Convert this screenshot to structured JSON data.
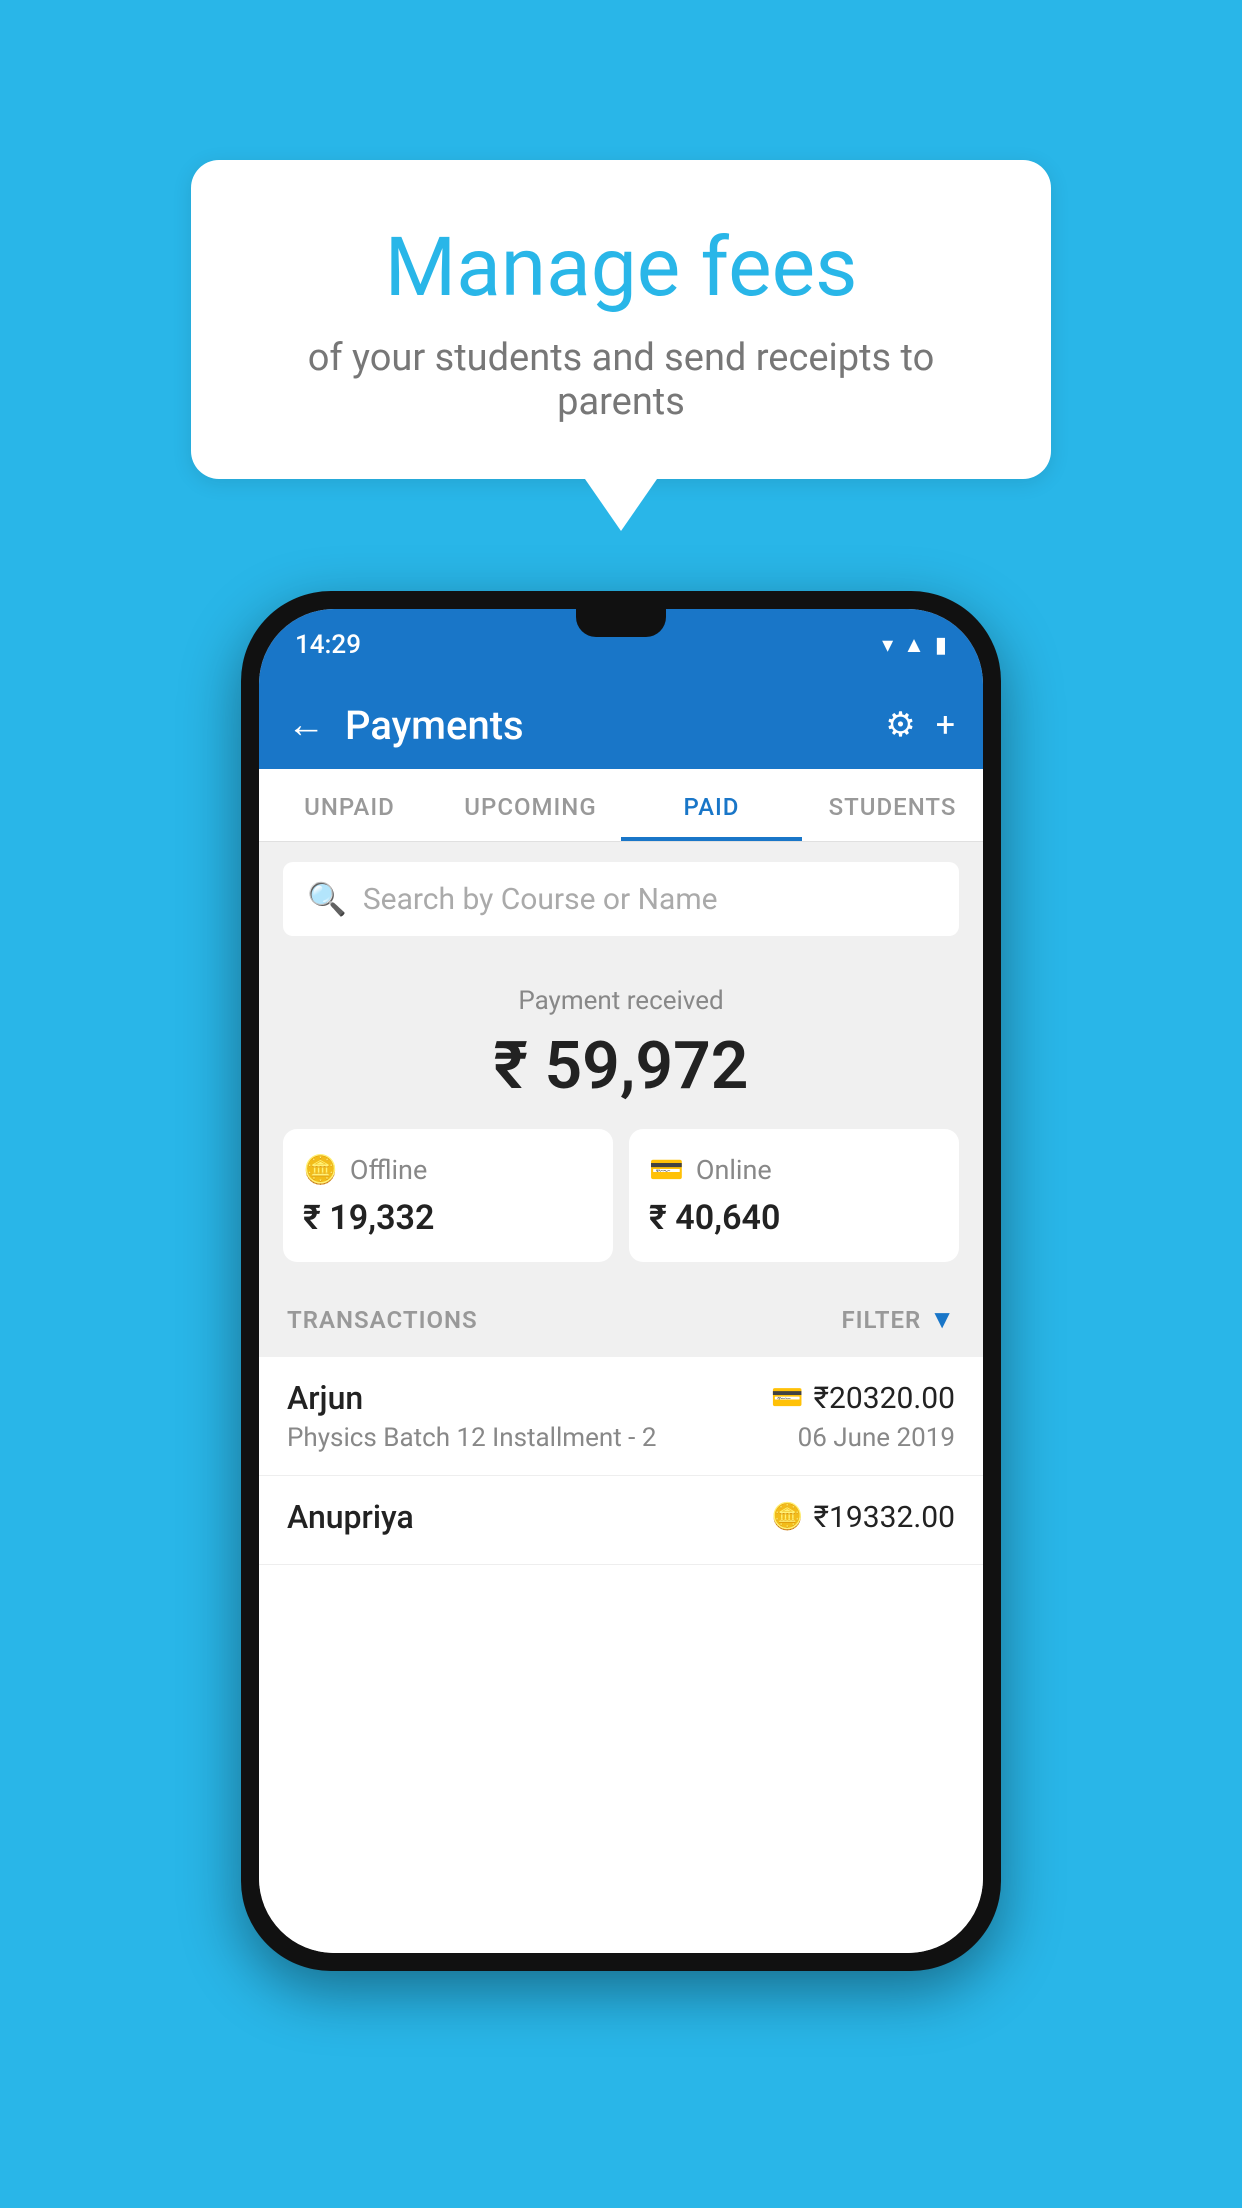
{
  "background_color": "#29b6e8",
  "speech_bubble": {
    "title": "Manage fees",
    "subtitle": "of your students and send receipts to parents"
  },
  "phone": {
    "status_bar": {
      "time": "14:29",
      "icons": [
        "wifi",
        "signal",
        "battery"
      ]
    },
    "header": {
      "title": "Payments",
      "back_label": "←",
      "gear_icon": "⚙",
      "plus_icon": "+"
    },
    "tabs": [
      {
        "label": "UNPAID",
        "active": false
      },
      {
        "label": "UPCOMING",
        "active": false
      },
      {
        "label": "PAID",
        "active": true
      },
      {
        "label": "STUDENTS",
        "active": false
      }
    ],
    "search": {
      "placeholder": "Search by Course or Name"
    },
    "payment_summary": {
      "received_label": "Payment received",
      "total_amount": "₹ 59,972",
      "offline": {
        "icon": "💳",
        "label": "Offline",
        "amount": "₹ 19,332"
      },
      "online": {
        "icon": "💳",
        "label": "Online",
        "amount": "₹ 40,640"
      }
    },
    "transactions_section": {
      "label": "TRANSACTIONS",
      "filter_label": "FILTER"
    },
    "transactions": [
      {
        "name": "Arjun",
        "pay_icon": "💳",
        "amount": "₹20320.00",
        "course": "Physics Batch 12 Installment - 2",
        "date": "06 June 2019"
      },
      {
        "name": "Anupriya",
        "pay_icon": "💳",
        "amount": "₹19332.00",
        "course": "",
        "date": ""
      }
    ]
  }
}
